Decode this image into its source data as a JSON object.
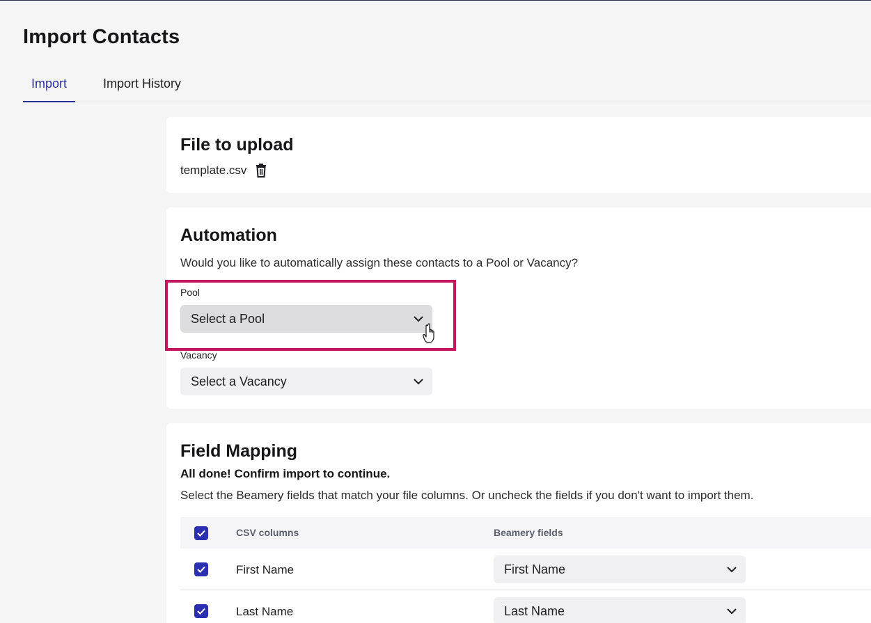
{
  "page": {
    "title": "Import Contacts",
    "tabs": [
      {
        "label": "Import",
        "active": true
      },
      {
        "label": "Import History",
        "active": false
      }
    ]
  },
  "file_upload": {
    "title": "File to upload",
    "file_name": "template.csv",
    "delete_icon": "trash-icon"
  },
  "automation": {
    "title": "Automation",
    "description": "Would you like to automatically assign these contacts to a Pool or Vacancy?",
    "pool": {
      "label": "Pool",
      "value": "Select a Pool"
    },
    "vacancy": {
      "label": "Vacancy",
      "value": "Select a Vacancy"
    }
  },
  "field_mapping": {
    "title": "Field Mapping",
    "status": "All done! Confirm import to continue.",
    "description": "Select the Beamery fields that match your file columns. Or uncheck the fields if you don't want to import them.",
    "columns": [
      "CSV columns",
      "Beamery fields"
    ],
    "rows": [
      {
        "csv": "First Name",
        "beamery": "First Name",
        "checked": true
      },
      {
        "csv": "Last Name",
        "beamery": "Last Name",
        "checked": true
      }
    ]
  },
  "colors": {
    "accent": "#2a2f9e",
    "highlight": "#c4155f",
    "checkbox": "#2b2fb0"
  }
}
